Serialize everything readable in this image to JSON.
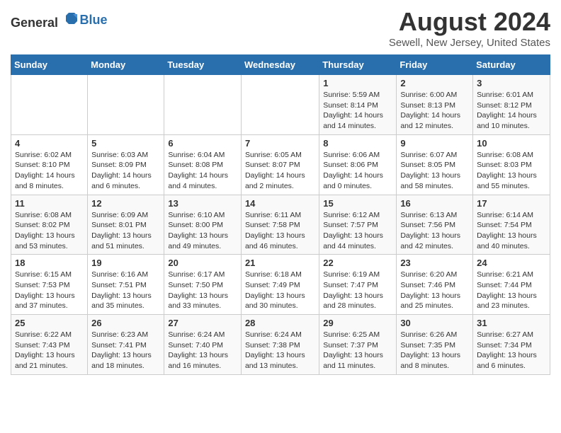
{
  "header": {
    "logo_general": "General",
    "logo_blue": "Blue",
    "month": "August 2024",
    "location": "Sewell, New Jersey, United States"
  },
  "weekdays": [
    "Sunday",
    "Monday",
    "Tuesday",
    "Wednesday",
    "Thursday",
    "Friday",
    "Saturday"
  ],
  "weeks": [
    [
      {
        "day": "",
        "info": ""
      },
      {
        "day": "",
        "info": ""
      },
      {
        "day": "",
        "info": ""
      },
      {
        "day": "",
        "info": ""
      },
      {
        "day": "1",
        "info": "Sunrise: 5:59 AM\nSunset: 8:14 PM\nDaylight: 14 hours and 14 minutes."
      },
      {
        "day": "2",
        "info": "Sunrise: 6:00 AM\nSunset: 8:13 PM\nDaylight: 14 hours and 12 minutes."
      },
      {
        "day": "3",
        "info": "Sunrise: 6:01 AM\nSunset: 8:12 PM\nDaylight: 14 hours and 10 minutes."
      }
    ],
    [
      {
        "day": "4",
        "info": "Sunrise: 6:02 AM\nSunset: 8:10 PM\nDaylight: 14 hours and 8 minutes."
      },
      {
        "day": "5",
        "info": "Sunrise: 6:03 AM\nSunset: 8:09 PM\nDaylight: 14 hours and 6 minutes."
      },
      {
        "day": "6",
        "info": "Sunrise: 6:04 AM\nSunset: 8:08 PM\nDaylight: 14 hours and 4 minutes."
      },
      {
        "day": "7",
        "info": "Sunrise: 6:05 AM\nSunset: 8:07 PM\nDaylight: 14 hours and 2 minutes."
      },
      {
        "day": "8",
        "info": "Sunrise: 6:06 AM\nSunset: 8:06 PM\nDaylight: 14 hours and 0 minutes."
      },
      {
        "day": "9",
        "info": "Sunrise: 6:07 AM\nSunset: 8:05 PM\nDaylight: 13 hours and 58 minutes."
      },
      {
        "day": "10",
        "info": "Sunrise: 6:08 AM\nSunset: 8:03 PM\nDaylight: 13 hours and 55 minutes."
      }
    ],
    [
      {
        "day": "11",
        "info": "Sunrise: 6:08 AM\nSunset: 8:02 PM\nDaylight: 13 hours and 53 minutes."
      },
      {
        "day": "12",
        "info": "Sunrise: 6:09 AM\nSunset: 8:01 PM\nDaylight: 13 hours and 51 minutes."
      },
      {
        "day": "13",
        "info": "Sunrise: 6:10 AM\nSunset: 8:00 PM\nDaylight: 13 hours and 49 minutes."
      },
      {
        "day": "14",
        "info": "Sunrise: 6:11 AM\nSunset: 7:58 PM\nDaylight: 13 hours and 46 minutes."
      },
      {
        "day": "15",
        "info": "Sunrise: 6:12 AM\nSunset: 7:57 PM\nDaylight: 13 hours and 44 minutes."
      },
      {
        "day": "16",
        "info": "Sunrise: 6:13 AM\nSunset: 7:56 PM\nDaylight: 13 hours and 42 minutes."
      },
      {
        "day": "17",
        "info": "Sunrise: 6:14 AM\nSunset: 7:54 PM\nDaylight: 13 hours and 40 minutes."
      }
    ],
    [
      {
        "day": "18",
        "info": "Sunrise: 6:15 AM\nSunset: 7:53 PM\nDaylight: 13 hours and 37 minutes."
      },
      {
        "day": "19",
        "info": "Sunrise: 6:16 AM\nSunset: 7:51 PM\nDaylight: 13 hours and 35 minutes."
      },
      {
        "day": "20",
        "info": "Sunrise: 6:17 AM\nSunset: 7:50 PM\nDaylight: 13 hours and 33 minutes."
      },
      {
        "day": "21",
        "info": "Sunrise: 6:18 AM\nSunset: 7:49 PM\nDaylight: 13 hours and 30 minutes."
      },
      {
        "day": "22",
        "info": "Sunrise: 6:19 AM\nSunset: 7:47 PM\nDaylight: 13 hours and 28 minutes."
      },
      {
        "day": "23",
        "info": "Sunrise: 6:20 AM\nSunset: 7:46 PM\nDaylight: 13 hours and 25 minutes."
      },
      {
        "day": "24",
        "info": "Sunrise: 6:21 AM\nSunset: 7:44 PM\nDaylight: 13 hours and 23 minutes."
      }
    ],
    [
      {
        "day": "25",
        "info": "Sunrise: 6:22 AM\nSunset: 7:43 PM\nDaylight: 13 hours and 21 minutes."
      },
      {
        "day": "26",
        "info": "Sunrise: 6:23 AM\nSunset: 7:41 PM\nDaylight: 13 hours and 18 minutes."
      },
      {
        "day": "27",
        "info": "Sunrise: 6:24 AM\nSunset: 7:40 PM\nDaylight: 13 hours and 16 minutes."
      },
      {
        "day": "28",
        "info": "Sunrise: 6:24 AM\nSunset: 7:38 PM\nDaylight: 13 hours and 13 minutes."
      },
      {
        "day": "29",
        "info": "Sunrise: 6:25 AM\nSunset: 7:37 PM\nDaylight: 13 hours and 11 minutes."
      },
      {
        "day": "30",
        "info": "Sunrise: 6:26 AM\nSunset: 7:35 PM\nDaylight: 13 hours and 8 minutes."
      },
      {
        "day": "31",
        "info": "Sunrise: 6:27 AM\nSunset: 7:34 PM\nDaylight: 13 hours and 6 minutes."
      }
    ]
  ]
}
